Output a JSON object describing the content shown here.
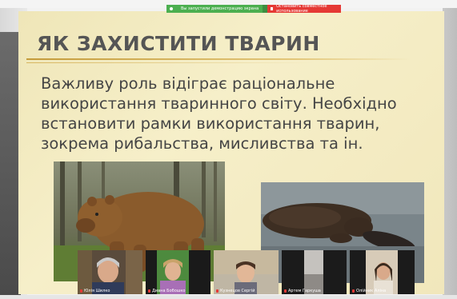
{
  "share_banner": {
    "status_text": "Вы запустили демонстрацию экрана",
    "stop_text": "Остановить совместное использование"
  },
  "slide": {
    "title": "ЯК ЗАХИСТИТИ ТВАРИН",
    "body_lines": [
      "Важливу роль відіграє раціональне",
      "використання тваринного світу. Необхідно",
      "встановити рамки використання тварин,",
      "зокрема рибальства, мисливства та ін."
    ]
  },
  "participants": [
    {
      "name": "Юлія Шилко"
    },
    {
      "name": "Диана Бобошко"
    },
    {
      "name": "Кузнецов Сергій"
    },
    {
      "name": "Артем Гаркуша"
    },
    {
      "name": "Олійник Аліна"
    }
  ]
}
